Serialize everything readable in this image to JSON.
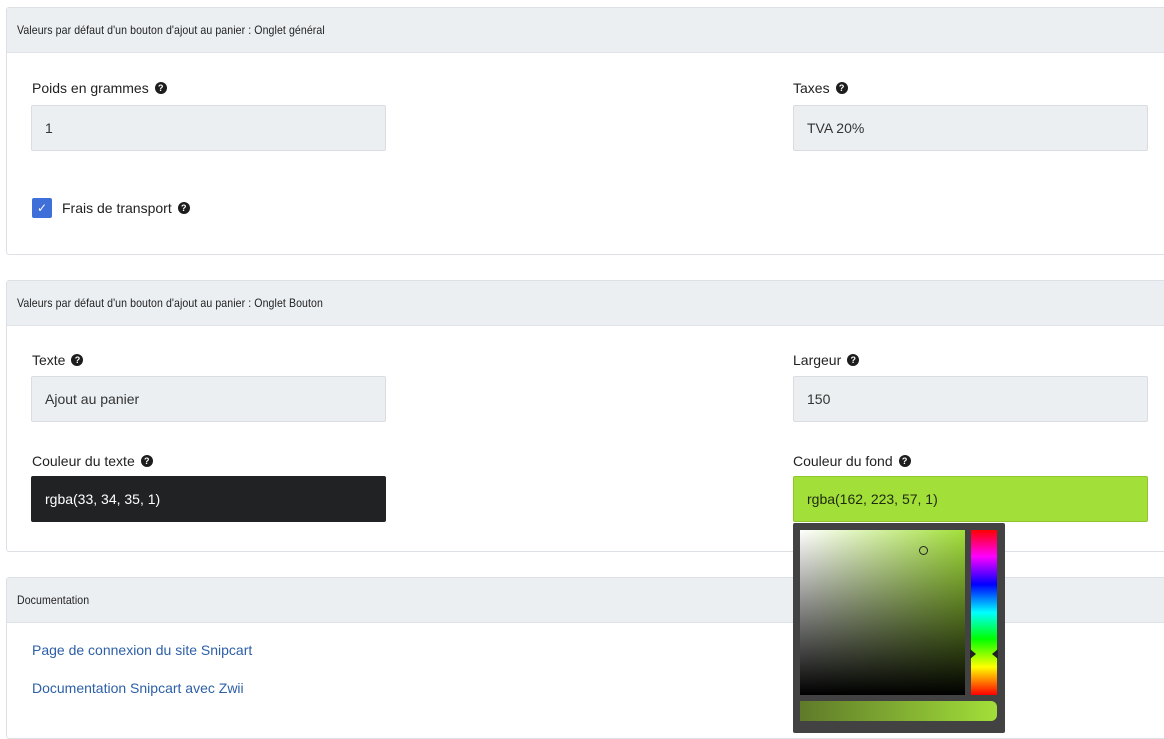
{
  "panel_general": {
    "title": "Valeurs par défaut d'un bouton d'ajout au panier : Onglet général",
    "weight_label": "Poids en grammes",
    "weight_value": "1",
    "tax_label": "Taxes",
    "tax_value": "TVA 20%",
    "shipping_label": "Frais de transport",
    "shipping_checked": true
  },
  "panel_button": {
    "title": "Valeurs par défaut d'un bouton d'ajout au panier : Onglet Bouton",
    "text_label": "Texte",
    "text_value": "Ajout au panier",
    "width_label": "Largeur",
    "width_value": "150",
    "text_color_label": "Couleur du texte",
    "text_color_value": "rgba(33, 34, 35, 1)",
    "bg_color_label": "Couleur du fond",
    "bg_color_value": "rgba(162, 223, 57, 1)"
  },
  "panel_docs": {
    "title": "Documentation",
    "links": [
      "Page de connexion du site Snipcart",
      "Documentation Snipcart avec Zwii"
    ]
  },
  "icons": {
    "help": "question-circle-icon",
    "check": "check-icon"
  },
  "colors": {
    "text_swatch": "#212223",
    "bg_swatch": "#a2df39",
    "link": "#2c5fa7",
    "checkbox": "#3f6fd8"
  }
}
